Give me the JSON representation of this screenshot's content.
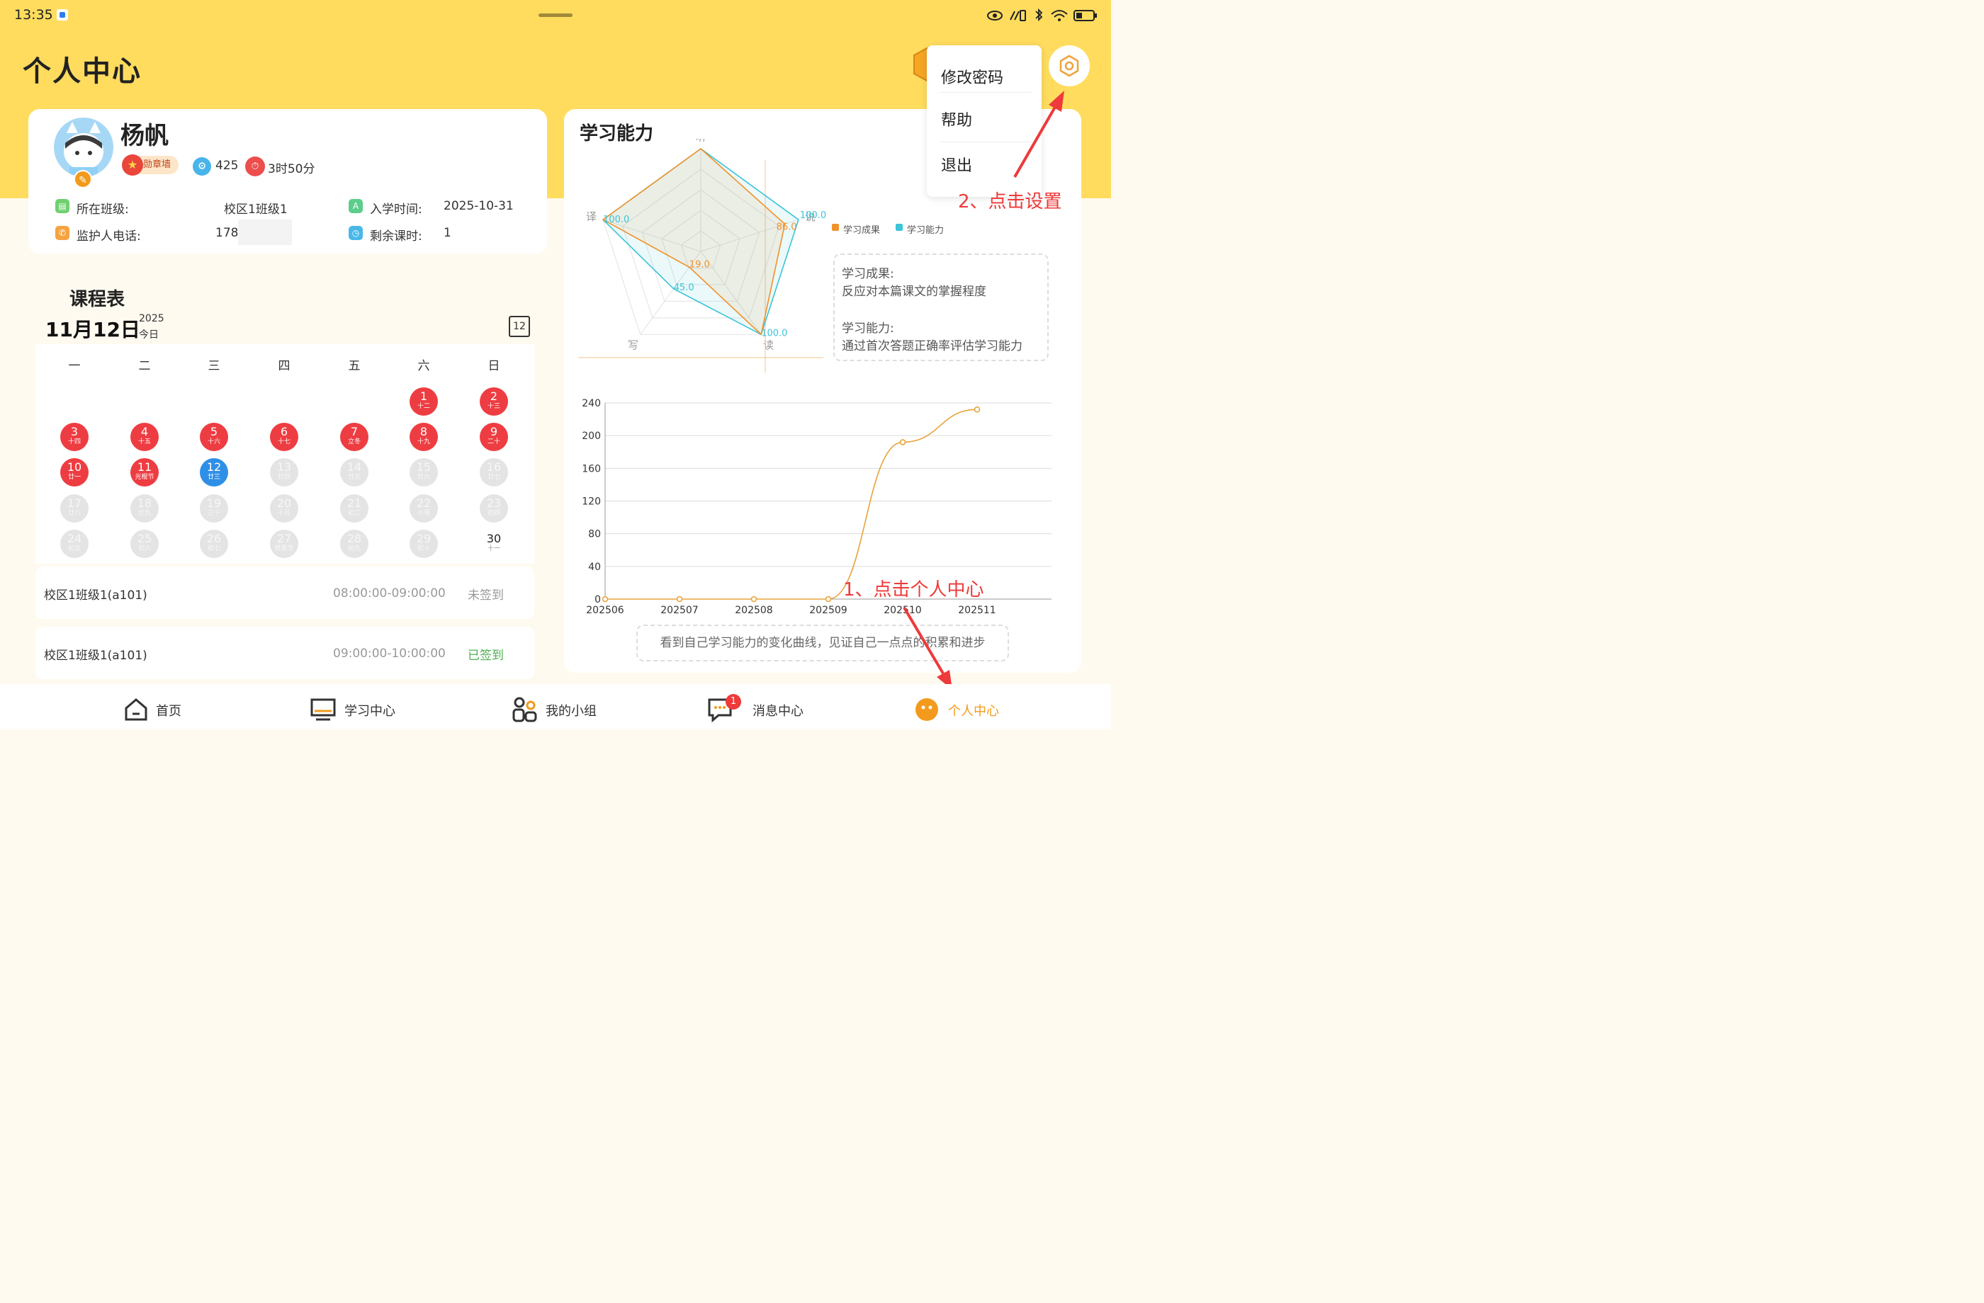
{
  "status_bar": {
    "time": "13:35"
  },
  "page_title": "个人中心",
  "profile": {
    "name": "杨帆",
    "badge_wall": "勋章墙",
    "points": "425",
    "study_time": "3时50分",
    "class_label": "所在班级:",
    "class_value": "校区1班级1",
    "enroll_label": "入学时间:",
    "enroll_value": "2025-10-31",
    "guardian_label": "监护人电话:",
    "guardian_value": "178(",
    "remaining_label": "剩余课时:",
    "remaining_value": "1"
  },
  "schedule": {
    "title": "课程表",
    "date": "11月12日",
    "year": "2025",
    "today": "今日",
    "calendar_icon_day": "12",
    "weekdays": [
      "一",
      "二",
      "三",
      "四",
      "五",
      "六",
      "日"
    ],
    "rows": [
      [
        null,
        null,
        null,
        null,
        null,
        {
          "n": "1",
          "l": "十二",
          "s": "red"
        },
        {
          "n": "2",
          "l": "十三",
          "s": "red"
        }
      ],
      [
        {
          "n": "3",
          "l": "十四",
          "s": "red"
        },
        {
          "n": "4",
          "l": "十五",
          "s": "red"
        },
        {
          "n": "5",
          "l": "十六",
          "s": "red"
        },
        {
          "n": "6",
          "l": "十七",
          "s": "red"
        },
        {
          "n": "7",
          "l": "立冬",
          "s": "red"
        },
        {
          "n": "8",
          "l": "十九",
          "s": "red"
        },
        {
          "n": "9",
          "l": "二十",
          "s": "red"
        }
      ],
      [
        {
          "n": "10",
          "l": "廿一",
          "s": "red"
        },
        {
          "n": "11",
          "l": "光棍节",
          "s": "red"
        },
        {
          "n": "12",
          "l": "廿三",
          "s": "blue"
        },
        {
          "n": "13",
          "l": "廿四",
          "s": "grey"
        },
        {
          "n": "14",
          "l": "廿五",
          "s": "grey"
        },
        {
          "n": "15",
          "l": "廿六",
          "s": "grey"
        },
        {
          "n": "16",
          "l": "廿七",
          "s": "grey"
        }
      ],
      [
        {
          "n": "17",
          "l": "廿八",
          "s": "grey"
        },
        {
          "n": "18",
          "l": "廿九",
          "s": "grey"
        },
        {
          "n": "19",
          "l": "三十",
          "s": "grey"
        },
        {
          "n": "20",
          "l": "十月",
          "s": "grey"
        },
        {
          "n": "21",
          "l": "初二",
          "s": "grey"
        },
        {
          "n": "22",
          "l": "小雪",
          "s": "grey"
        },
        {
          "n": "23",
          "l": "初四",
          "s": "grey"
        }
      ],
      [
        {
          "n": "24",
          "l": "初五",
          "s": "grey"
        },
        {
          "n": "25",
          "l": "初六",
          "s": "grey"
        },
        {
          "n": "26",
          "l": "初七",
          "s": "grey"
        },
        {
          "n": "27",
          "l": "感恩节",
          "s": "grey"
        },
        {
          "n": "28",
          "l": "初九",
          "s": "grey"
        },
        {
          "n": "29",
          "l": "初十",
          "s": "grey"
        },
        {
          "n": "30",
          "l": "十一",
          "s": "plain"
        }
      ]
    ],
    "courses": [
      {
        "name": "校区1班级1(a101)",
        "time": "08:00:00-09:00:00",
        "status": "未签到",
        "status_color": "#999999"
      },
      {
        "name": "校区1班级1(a101)",
        "time": "09:00:00-10:00:00",
        "status": "已签到",
        "status_color": "#4caf50"
      }
    ]
  },
  "ability": {
    "title": "学习能力",
    "legend": [
      {
        "name": "学习成果",
        "color": "#f0922b"
      },
      {
        "name": "学习能力",
        "color": "#3cc4d8"
      }
    ],
    "note_title_1": "学习成果:",
    "note_text_1": "反应对本篇课文的掌握程度",
    "note_title_2": "学习能力:",
    "note_text_2": "通过首次答题正确率评估学习能力",
    "bottom_note": "看到自己学习能力的变化曲线，见证自己一点点的积累和进步"
  },
  "chart_data": [
    {
      "type": "radar",
      "axes": [
        "听",
        "说",
        "读",
        "写",
        "译"
      ],
      "max": 100,
      "series": [
        {
          "name": "学习成果",
          "values": [
            100,
            86.0,
            100,
            19.0,
            100
          ],
          "color": "#f0922b"
        },
        {
          "name": "学习能力",
          "values": [
            100,
            100.0,
            100.0,
            45.0,
            100.0
          ],
          "color": "#3cc4d8"
        }
      ],
      "data_labels": [
        "100.0",
        "86.0",
        "100.0",
        "19.0",
        "45.0",
        "100.0"
      ]
    },
    {
      "type": "line",
      "x": [
        "202506",
        "202507",
        "202508",
        "202509",
        "202510",
        "202511"
      ],
      "values": [
        0,
        0,
        0,
        0,
        192,
        232
      ],
      "yticks": [
        "0",
        "40",
        "80",
        "120",
        "160",
        "200",
        "240"
      ],
      "ylim": [
        0,
        240
      ],
      "color": "#e8a33b"
    }
  ],
  "settings_menu": {
    "items": [
      "修改密码",
      "帮助",
      "退出"
    ]
  },
  "annotations": {
    "click_settings": "2、点击设置",
    "click_profile": "1、点击个人中心"
  },
  "nav": {
    "items": [
      {
        "label": "首页",
        "icon": "home-icon"
      },
      {
        "label": "学习中心",
        "icon": "monitor-icon"
      },
      {
        "label": "我的小组",
        "icon": "group-icon"
      },
      {
        "label": "消息中心",
        "icon": "message-icon",
        "badge": "1"
      },
      {
        "label": "个人中心",
        "icon": "profile-icon",
        "active": true
      }
    ]
  }
}
